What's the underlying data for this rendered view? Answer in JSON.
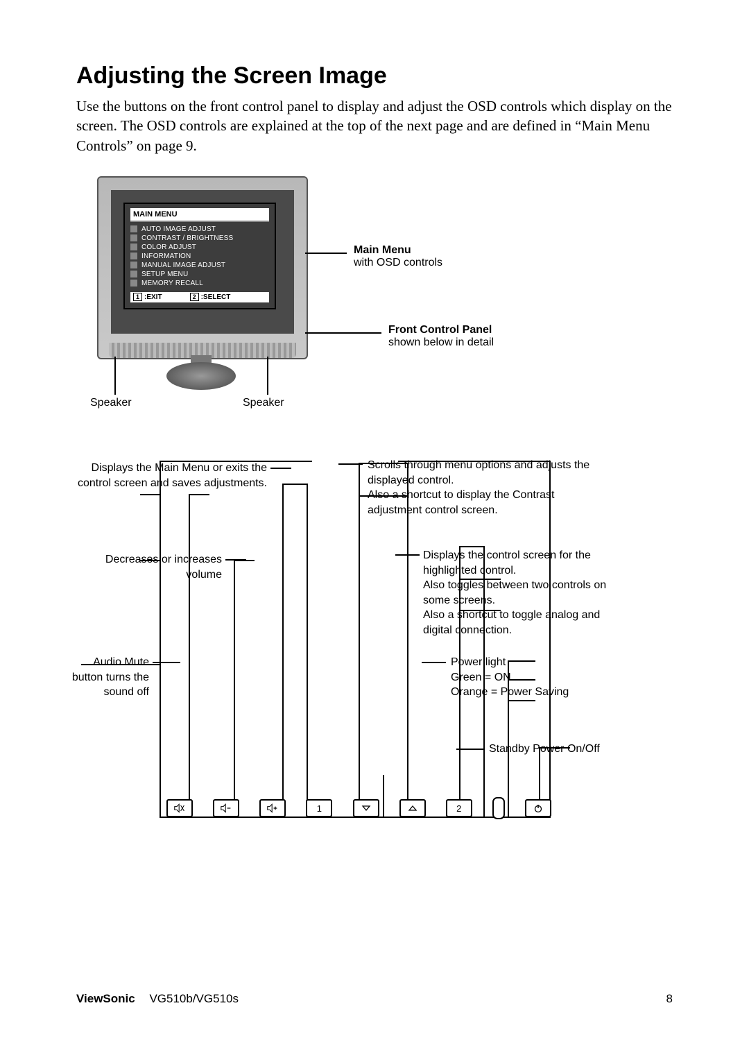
{
  "title": "Adjusting the Screen Image",
  "intro": "Use the buttons on the front control panel to display and adjust the OSD controls which display on the screen. The OSD controls are explained at the top of the next page and are defined in “Main Menu Controls” on page 9.",
  "osd": {
    "header": "MAIN MENU",
    "items": [
      "AUTO IMAGE ADJUST",
      "CONTRAST / BRIGHTNESS",
      "COLOR ADJUST",
      "INFORMATION",
      "MANUAL IMAGE ADJUST",
      "SETUP MENU",
      "MEMORY RECALL"
    ],
    "exit_key": "1",
    "exit_label": ":EXIT",
    "select_key": "2",
    "select_label": ":SELECT"
  },
  "monitor_brand": "ViewSonic",
  "right_labels": {
    "main_menu_hdr": "Main Menu",
    "main_menu_sub": "with OSD controls",
    "fcp_hdr": "Front Control Panel",
    "fcp_sub": "shown below in detail"
  },
  "speaker_label": "Speaker",
  "callouts": {
    "btn1_a": "Displays the Main Menu or exits the control screen and saves adjustments.",
    "vol": "Decreases or increases volume",
    "mute": "Audio Mute button turns the sound off",
    "scroll_a": "Scrolls through menu options and adjusts the displayed control.",
    "scroll_b": "Also a shortcut to display the Contrast adjustment control screen.",
    "btn2_a": "Displays the control screen for the highlighted control.",
    "btn2_b": "Also toggles between two controls on some screens.",
    "btn2_c": "Also a shortcut to toggle analog and digital connection.",
    "pwr_a": "Power light",
    "pwr_b": "Green = ON",
    "pwr_c": "Orange = Power Saving",
    "standby": "Standby Power On/Off"
  },
  "buttons": {
    "b1": "1",
    "b2": "2"
  },
  "footer": {
    "brand": "ViewSonic",
    "model": "VG510b/VG510s",
    "page": "8"
  }
}
